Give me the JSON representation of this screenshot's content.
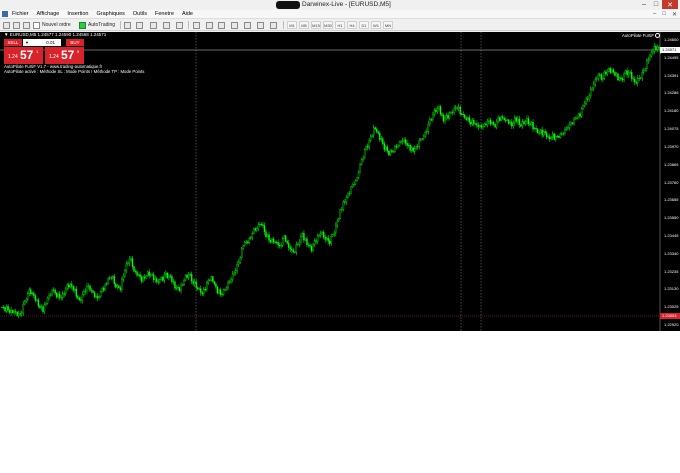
{
  "window": {
    "title": "Darwinex-Live - [EURUSD,M5]"
  },
  "window_buttons": [
    "–",
    "□",
    "✕"
  ],
  "menu": {
    "items": [
      "Fichier",
      "Affichage",
      "Insertion",
      "Graphiques",
      "Outils",
      "Fenetre",
      "Aide"
    ]
  },
  "toolbar": {
    "new_order_label": "Nouvel ordre",
    "autotrading_label": "AutoTrading",
    "timeframes": [
      "M1",
      "M5",
      "M15",
      "M30",
      "H1",
      "H4",
      "D1",
      "W1",
      "MN"
    ]
  },
  "chart": {
    "symbol_info": "▼ EURUSD,M5  1.24577 1.24590 1.24568 1.24571",
    "ea_name": "AutoPilote FurtiF",
    "ea_line1": "AutoPilote FurtiF V1.7 - www.trading-automatique.fr",
    "ea_line2": "AutoPilote activé : Méthode SL : Mode Points  !  Méthode TP : Mode Points",
    "price_tag": "1.24571",
    "red_tag": "1.23003",
    "y_ticks": [
      "1.24600",
      "1.24495",
      "1.24391",
      "1.24286",
      "1.24180",
      "1.24075",
      "1.23970",
      "1.23865",
      "1.23760",
      "1.23655",
      "1.23550",
      "1.23445",
      "1.23340",
      "1.23235",
      "1.23130",
      "1.23025",
      "1.22920"
    ]
  },
  "trade_panel": {
    "sell_label": "SELL",
    "buy_label": "BUY",
    "lot_value": "0.01",
    "lot_arrow": "▼",
    "sell_price_small": "1.24",
    "sell_price_big": "57",
    "sell_price_sup": "1",
    "buy_price_small": "1.24",
    "buy_price_big": "57",
    "buy_price_sup": "5"
  },
  "chart_data": {
    "type": "candlestick",
    "ylim": [
      1.2288,
      1.2468
    ],
    "colors": {
      "up": "#00ff00",
      "down": "#00ff00",
      "background": "#000000",
      "stop_line": "#d9232a"
    },
    "close_series": [
      1.2298,
      1.2297,
      1.2296,
      1.2294,
      1.2293,
      1.2301,
      1.2308,
      1.2305,
      1.23,
      1.2296,
      1.2304,
      1.2309,
      1.2306,
      1.2304,
      1.231,
      1.2312,
      1.2308,
      1.2302,
      1.2307,
      1.2311,
      1.2306,
      1.2303,
      1.2309,
      1.2314,
      1.2318,
      1.2312,
      1.231,
      1.2323,
      1.233,
      1.2322,
      1.2317,
      1.2316,
      1.232,
      1.2318,
      1.2314,
      1.2316,
      1.2318,
      1.2316,
      1.2311,
      1.2309,
      1.2316,
      1.2319,
      1.2314,
      1.2311,
      1.2307,
      1.2312,
      1.2317,
      1.231,
      1.2306,
      1.2309,
      1.2314,
      1.232,
      1.2327,
      1.2338,
      1.234,
      1.2345,
      1.2349,
      1.2352,
      1.2344,
      1.2341,
      1.2339,
      1.2337,
      1.2342,
      1.2336,
      1.2333,
      1.2338,
      1.2344,
      1.2339,
      1.2335,
      1.2341,
      1.2346,
      1.2342,
      1.234,
      1.2347,
      1.2356,
      1.2364,
      1.237,
      1.2375,
      1.238,
      1.2392,
      1.2399,
      1.2406,
      1.2413,
      1.2406,
      1.24,
      1.2396,
      1.2398,
      1.2402,
      1.2405,
      1.2401,
      1.2398,
      1.24,
      1.2404,
      1.2408,
      1.2416,
      1.2422,
      1.2424,
      1.2418,
      1.242,
      1.2423,
      1.2426,
      1.2421,
      1.2419,
      1.2416,
      1.2414,
      1.2412,
      1.2414,
      1.2416,
      1.2413,
      1.2417,
      1.2418,
      1.2416,
      1.2415,
      1.2418,
      1.2414,
      1.2417,
      1.2415,
      1.2412,
      1.241,
      1.2408,
      1.2406,
      1.2407,
      1.2405,
      1.2408,
      1.2412,
      1.2414,
      1.2418,
      1.2421,
      1.2428,
      1.2434,
      1.2441,
      1.2446,
      1.2444,
      1.245,
      1.2448,
      1.2445,
      1.2443,
      1.2447,
      1.2446,
      1.2441,
      1.2443,
      1.2449,
      1.2456,
      1.2461,
      1.2465,
      1.2458
    ]
  }
}
